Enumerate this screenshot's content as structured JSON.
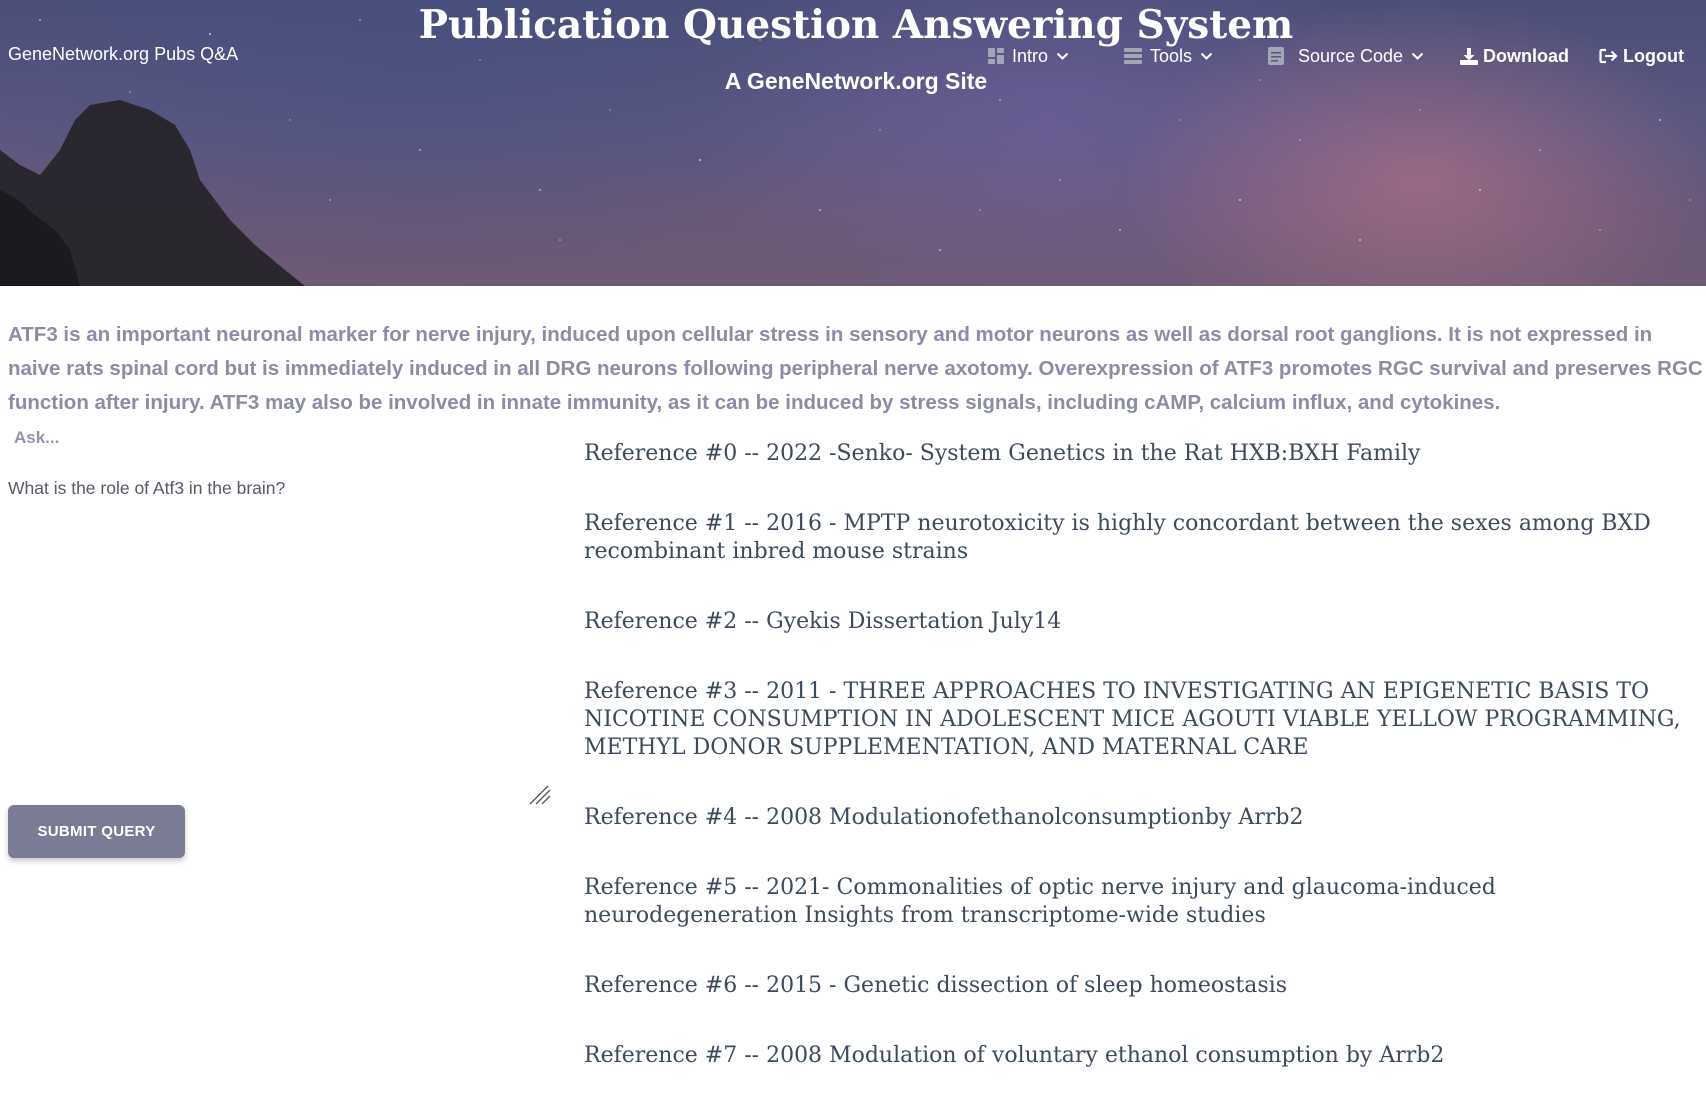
{
  "header": {
    "brand": "GeneNetwork.org Pubs Q&A",
    "title": "Publication Question Answering System",
    "subtitle": "A GeneNetwork.org Site"
  },
  "nav": {
    "intro": "Intro",
    "tools": "Tools",
    "source_code": "Source Code",
    "download": "Download",
    "logout": "Logout"
  },
  "icons": [
    "dashboard-icon",
    "tools-icon",
    "document-icon",
    "chevron-down-icon",
    "download-icon",
    "logout-icon",
    "resize-grip-icon"
  ],
  "summary": "ATF3 is an important neuronal marker for nerve injury, induced upon cellular stress in sensory and motor neurons as well as dorsal root ganglions. It is not expressed in naive rats spinal cord but is immediately induced in all DRG neurons following peripheral nerve axotomy. Overexpression of ATF3 promotes RGC survival and preserves RGC function after injury. ATF3 may also be involved in innate immunity, as it can be induced by stress signals, including cAMP, calcium influx, and cytokines.",
  "query": {
    "label": "Ask...",
    "value": "What is the role of Atf3 in the brain?",
    "submit_label": "SUBMIT QUERY"
  },
  "references": [
    "Reference #0 -- 2022 -Senko- System Genetics in the Rat HXB:BXH Family",
    "Reference #1 -- 2016 - MPTP neurotoxicity is highly concordant between the sexes among BXD recombinant inbred mouse strains",
    "Reference #2 -- Gyekis Dissertation July14",
    "Reference #3 -- 2011 - THREE APPROACHES TO INVESTIGATING AN EPIGENETIC BASIS TO NICOTINE CONSUMPTION IN ADOLESCENT MICE AGOUTI VIABLE YELLOW PROGRAMMING, METHYL DONOR SUPPLEMENTATION, AND MATERNAL CARE",
    "Reference #4 -- 2008 Modulationofethanolconsumptionby Arrb2",
    "Reference #5 -- 2021- Commonalities of optic nerve injury and glaucoma-induced neurodegeneration Insights from transcriptome-wide studies",
    "Reference #6 -- 2015 - Genetic dissection of sleep homeostasis",
    "Reference #7 -- 2008 Modulation of voluntary ethanol consumption by Arrb2"
  ]
}
